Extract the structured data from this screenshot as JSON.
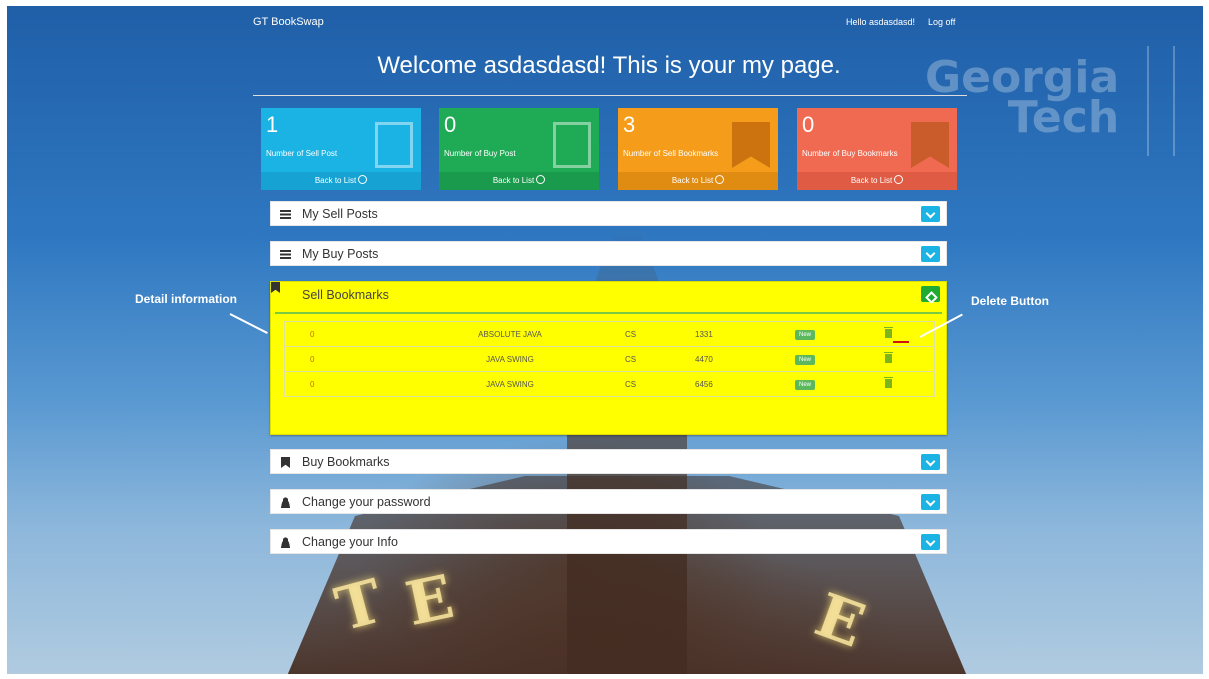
{
  "nav": {
    "brand": "GT BookSwap",
    "greeting": "Hello asdasdasd!",
    "logoff": "Log off"
  },
  "welcome": {
    "prefix": "Welcome ",
    "username": "asdasdasd!",
    "suffix": " This is your my page."
  },
  "logo": {
    "line1": "Georgia",
    "line2": "Tech"
  },
  "stats": [
    {
      "value": "1",
      "label": "Number of Sell Post",
      "footer": "Back to List",
      "color": "#1bb2e4"
    },
    {
      "value": "0",
      "label": "Number of Buy Post",
      "footer": "Back to List",
      "color": "#1faa55"
    },
    {
      "value": "3",
      "label": "Number of Sell Bookmarks",
      "footer": "Back to List",
      "color": "#f59d1a"
    },
    {
      "value": "0",
      "label": "Number of Buy Bookmarks",
      "footer": "Back to List",
      "color": "#f06a52"
    }
  ],
  "panels": {
    "sell_posts": "My Sell Posts",
    "buy_posts": "My Buy Posts",
    "sell_bookmarks": "Sell Bookmarks",
    "buy_bookmarks": "Buy Bookmarks",
    "change_password": "Change your password",
    "change_info": "Change your Info"
  },
  "sell_bookmarks_rows": [
    {
      "id": "0",
      "title": "ABSOLUTE JAVA",
      "dept": "CS",
      "number": "1331",
      "status": "New"
    },
    {
      "id": "0",
      "title": "JAVA SWING",
      "dept": "CS",
      "number": "4470",
      "status": "New"
    },
    {
      "id": "0",
      "title": "JAVA SWING",
      "dept": "CS",
      "number": "6456",
      "status": "New"
    }
  ],
  "annotations": {
    "detail": "Detail information",
    "delete": "Delete Button"
  }
}
